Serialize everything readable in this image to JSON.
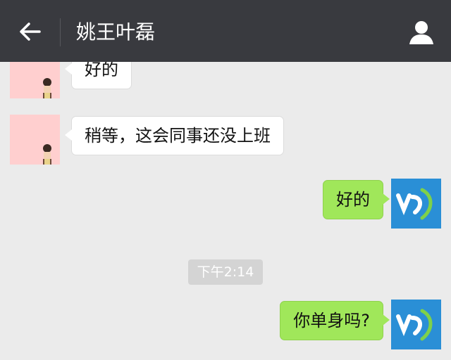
{
  "header": {
    "title": "姚王叶磊",
    "background": "#393a3f"
  },
  "messages": [
    {
      "side": "left",
      "text": "好的"
    },
    {
      "side": "left",
      "text": "稍等，这会同事还没上班"
    },
    {
      "side": "right",
      "text": "好的"
    },
    {
      "side": "right",
      "text": "你单身吗?"
    }
  ],
  "timestamp": "下午2:14",
  "colors": {
    "chat_background": "#ebebeb",
    "sent_bubble": "#a0e75a",
    "received_bubble": "#ffffff",
    "contact_avatar": "#ffcfcf",
    "my_avatar": "#2a8fd6"
  },
  "icons": {
    "back": "arrow-left-icon",
    "profile": "person-icon"
  }
}
